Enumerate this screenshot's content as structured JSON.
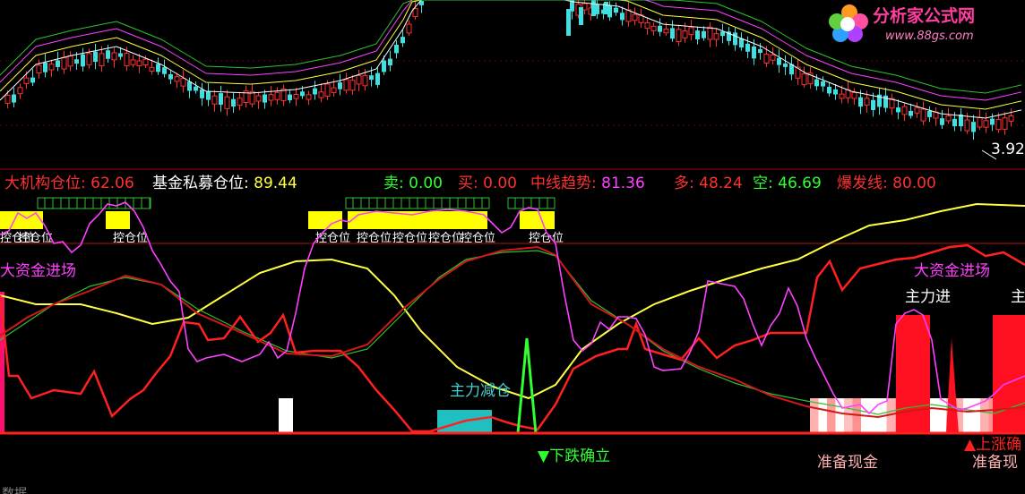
{
  "price_panel": {
    "last_price_label": "3.92"
  },
  "indicator_header": [
    {
      "name": "大机构仓位:",
      "value": "62.06",
      "name_color": "#ff3030",
      "value_color": "#ff3030"
    },
    {
      "name": "基金私募仓位:",
      "value": "89.44",
      "name_color": "#ffffff",
      "value_color": "#ffff40"
    },
    {
      "name": "卖:",
      "value": "0.00",
      "name_color": "#30ff30",
      "value_color": "#30ff30"
    },
    {
      "name": "买:",
      "value": "0.00",
      "name_color": "#ff3030",
      "value_color": "#ff3030"
    },
    {
      "name": "中线趋势:",
      "value": "81.36",
      "name_color": "#ff3030",
      "value_color": "#ff40ff"
    },
    {
      "name": "多:",
      "value": "48.24",
      "name_color": "#ff3030",
      "value_color": "#ff3030"
    },
    {
      "name": "空:",
      "value": "46.69",
      "name_color": "#30ff30",
      "value_color": "#30ff30"
    },
    {
      "name": "爆发线:",
      "value": "80.00",
      "name_color": "#ff3030",
      "value_color": "#ff3030"
    }
  ],
  "annotations": {
    "big_funds_left": "大资金进场",
    "big_funds_right": "大资金进场",
    "main_force_in": "主力进",
    "main_force_in_cut": "主",
    "main_force_reduce": "主力减仓",
    "decline_confirmed": "▼下跌确立",
    "prepare_cash_1": "准备现金",
    "prepare_cash_2": "准备现",
    "rise_confirmed": "▲上涨确",
    "position_tag": "控仓位",
    "bottom_cut": "数据"
  },
  "logo": {
    "title": "分析家公式网",
    "url": "www.88gs.com"
  },
  "colors": {
    "background": "#000000",
    "up_candle": "#ff3030",
    "down_candle": "#40e0e0",
    "ma_white": "#ffffff",
    "ma_yellow": "#ffff40",
    "ma_magenta": "#ff40ff",
    "ma_green": "#30c030",
    "separator": "#a00000"
  },
  "chart_data": {
    "type": "line",
    "panels": [
      "price",
      "indicator"
    ],
    "price_last": 3.92,
    "indicator_series": [
      {
        "name": "大机构仓位",
        "color": "#ff3030",
        "last": 62.06
      },
      {
        "name": "基金私募仓位",
        "color": "#ffff40",
        "last": 89.44
      },
      {
        "name": "中线趋势",
        "color": "#ff40ff",
        "last": 81.36
      },
      {
        "name": "多",
        "color": "#ff3030",
        "last": 48.24
      },
      {
        "name": "空",
        "color": "#30ff30",
        "last": 46.69
      },
      {
        "name": "爆发线",
        "color": "#ff3030",
        "last": 80.0
      }
    ],
    "sell": 0.0,
    "buy": 0.0,
    "grid": false,
    "legend": "top-left"
  }
}
